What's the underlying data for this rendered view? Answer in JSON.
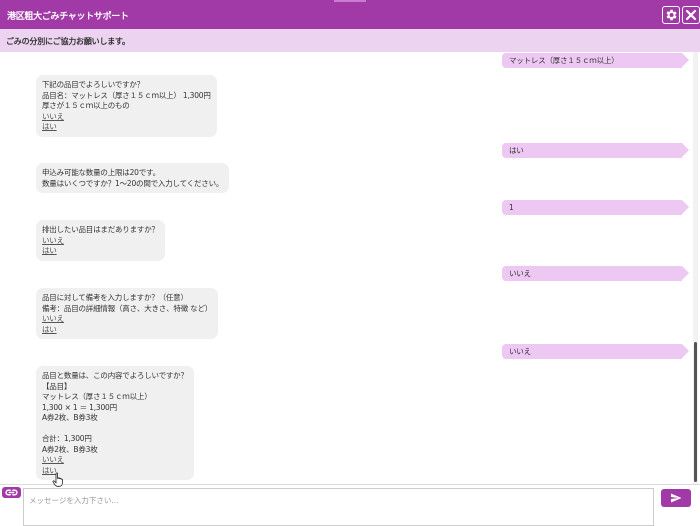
{
  "header": {
    "title": "港区粗大ごみチャットサポート",
    "settings_icon": "gear-icon",
    "close_icon": "close-icon"
  },
  "notice": {
    "text": "ごみの分別にご協力お願いします。"
  },
  "messages": {
    "user0": "マットレス（厚さ１５ｃｍ以上）",
    "bot1": {
      "lines": [
        "下記の品目でよろしいですか？",
        "品目名：マットレス（厚さ１５ｃｍ以上） 1,300円",
        "厚さが１５ｃｍ以上のもの"
      ],
      "options": [
        "いいえ",
        "はい"
      ]
    },
    "user1": "はい",
    "bot2": {
      "lines": [
        "申込み可能な数量の上限は20です。",
        "数量はいくつですか？1〜20の間で入力してください。"
      ]
    },
    "user2": "1",
    "bot3": {
      "lines": [
        "排出したい品目はまだありますか？"
      ],
      "options": [
        "いいえ",
        "はい"
      ]
    },
    "user3": "いいえ",
    "bot4": {
      "lines": [
        "品目に対して備考を入力しますか？（任意）",
        "備考：品目の詳細情報（高さ、大きさ、特徴 など）"
      ],
      "options": [
        "いいえ",
        "はい"
      ]
    },
    "user4": "いいえ",
    "bot5": {
      "lines": [
        "品目と数量は、この内容でよろしいですか？",
        "【品目】",
        "マットレス（厚さ１５ｃｍ以上）",
        "1,300 × 1 ＝ 1,300円",
        "A券2枚、B券3枚",
        "",
        "合計：1,300円",
        "A券2枚、B券3枚"
      ],
      "options": [
        "いいえ",
        "はい"
      ]
    }
  },
  "composer": {
    "placeholder": "メッセージを入力下さい...",
    "value": "",
    "attach_icon": "link-icon",
    "send_icon": "send-icon"
  },
  "colors": {
    "brand": "#a13aa7",
    "notice_bg": "#ecd3f0",
    "user_bubble": "#ecc8f2",
    "bot_bubble": "#f0f0f0"
  }
}
